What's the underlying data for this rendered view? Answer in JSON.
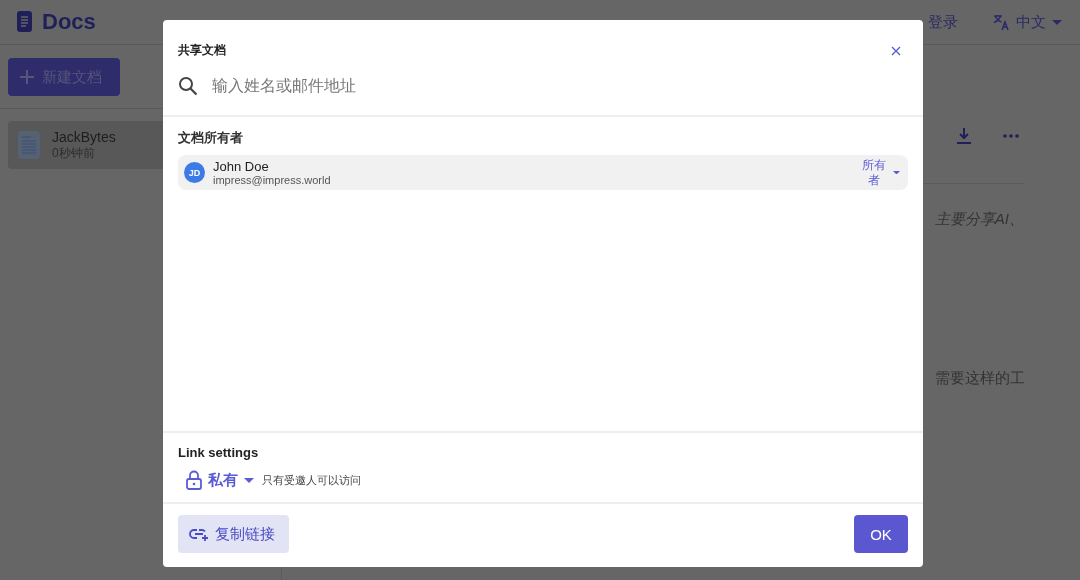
{
  "app": {
    "logo": "Docs",
    "header_link": "登录",
    "language": "中文",
    "new_doc_button": "新建文档",
    "documents": [
      {
        "title": "JackBytes",
        "time": "0秒钟前",
        "selected": true
      }
    ],
    "content_lines": [
      "主要分享AI、",
      "需要这样的工"
    ]
  },
  "dialog": {
    "title": "共享文档",
    "search": {
      "placeholder": "输入姓名或邮件地址"
    },
    "owners_heading": "文档所有者",
    "members": [
      {
        "initials": "JD",
        "name": "John Doe",
        "email": "impress@impress.world",
        "role": "所有者"
      }
    ],
    "link_settings": {
      "heading": "Link settings",
      "visibility": "私有",
      "description": "只有受邀人可以访问"
    },
    "buttons": {
      "copy_link": "复制链接",
      "ok": "OK"
    }
  }
}
